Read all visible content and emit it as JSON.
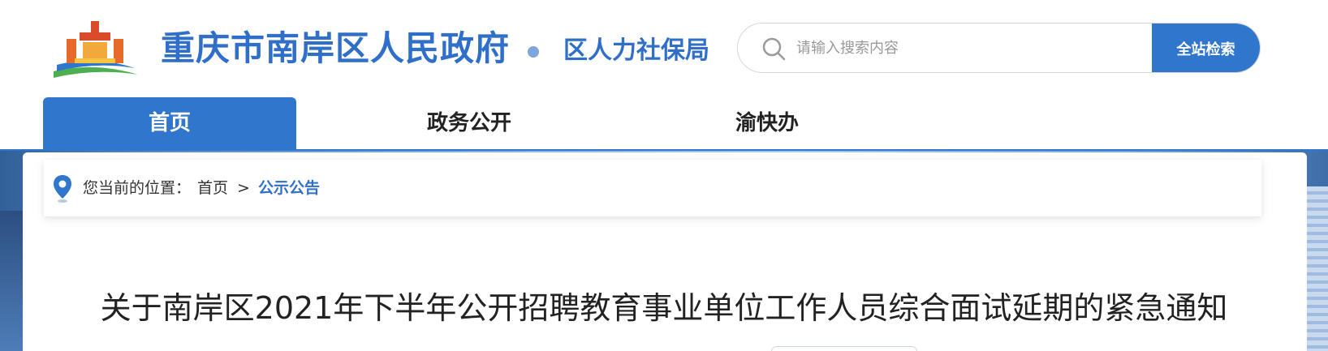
{
  "header": {
    "site_title": "重庆市南岸区人民政府",
    "dept_title": "区人力社保局",
    "logo_icon": "government-emblem-logo",
    "search": {
      "placeholder": "请输入搜索内容",
      "value": "",
      "button_label": "全站检索",
      "icon": "search-icon"
    }
  },
  "nav": {
    "items": [
      {
        "label": "首页",
        "active": true
      },
      {
        "label": "政务公开",
        "active": false
      },
      {
        "label": "渝快办",
        "active": false
      }
    ]
  },
  "breadcrumb": {
    "icon": "location-pin-icon",
    "prefix": "您当前的位置：",
    "home": "首页",
    "separator": ">",
    "current": "公示公告"
  },
  "article": {
    "title": "关于南岸区2021年下半年公开招聘教育事业单位工作人员综合面试延期的紧急通知"
  },
  "colors": {
    "brand_blue": "#2f76cc",
    "title_blue": "#2f6fc9"
  }
}
